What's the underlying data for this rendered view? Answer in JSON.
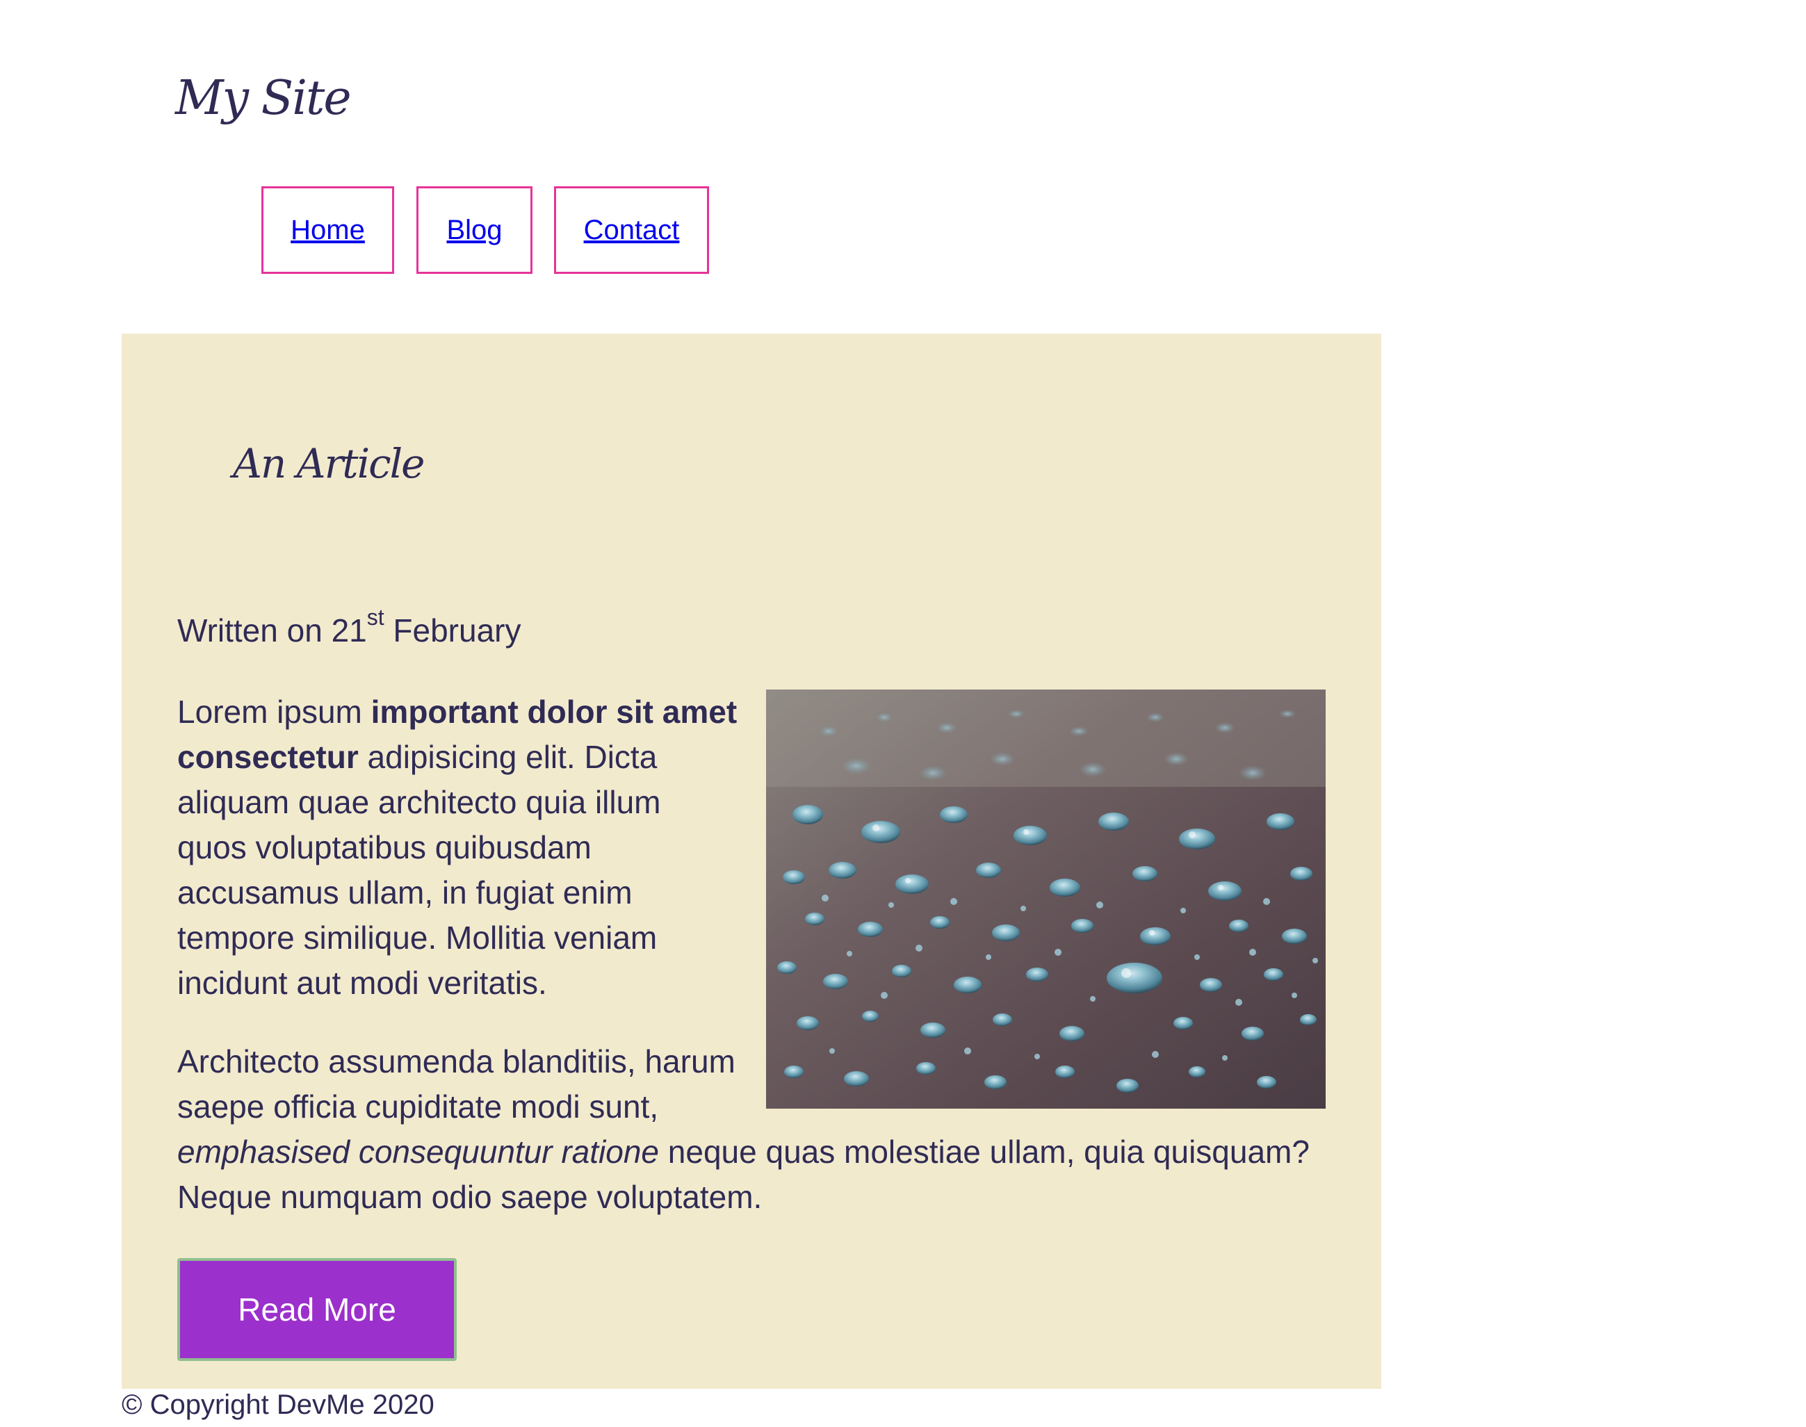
{
  "header": {
    "site_title": "My Site"
  },
  "nav": {
    "items": [
      {
        "label": "Home"
      },
      {
        "label": "Blog"
      },
      {
        "label": "Contact"
      }
    ]
  },
  "article": {
    "title": "An Article",
    "date_prefix": "Written on 21",
    "date_suffix": "st",
    "date_month": "February",
    "p1_start": "Lorem ipsum ",
    "p1_bold": "important dolor sit amet consectetur",
    "p1_end": " adipisicing elit. Dicta aliquam quae architecto quia illum quos voluptatibus quibusdam accusamus ullam, in fugiat enim tempore similique. Mollitia veniam incidunt aut modi veritatis.",
    "p2_start": "Architecto assumenda blanditiis, harum saepe officia cupiditate modi sunt, ",
    "p2_em": "emphasised consequuntur ratione",
    "p2_end": " neque quas molestiae ullam, quia quisquam? Neque numquam odio saepe voluptatem.",
    "read_more_label": "Read More"
  },
  "footer": {
    "copyright": "© Copyright DevMe 2020"
  },
  "colors": {
    "text": "#2f2b55",
    "article_bg": "#f2eacd",
    "nav_border": "#e8339a",
    "link": "#0000ee",
    "button_bg": "#9b30cc",
    "button_border": "#8fbf8f"
  }
}
